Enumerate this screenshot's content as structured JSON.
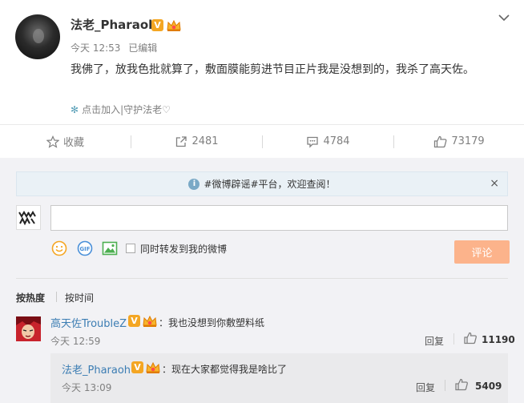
{
  "post": {
    "username": "法老_Pharaoh",
    "verified_badge": "V",
    "time": "今天 12:53",
    "edited": "已编辑",
    "content": "我佛了，放我色批就算了，敷面膜能剪进节目正片我是没想到的，我杀了高天佐。",
    "source": "点击加入|守护法老♡",
    "actions": {
      "favorite": "收藏",
      "repost": "2481",
      "comment": "4784",
      "like": "73179"
    }
  },
  "notice": {
    "text": "#微博辟谣#平台，欢迎查阅！",
    "close": "×"
  },
  "composer": {
    "input_value": "",
    "also_repost": "同时转发到我的微博",
    "submit": "评论"
  },
  "sort": {
    "by_hot": "按热度",
    "by_time": "按时间"
  },
  "comments": [
    {
      "username": "高天佐TroubleZ",
      "verified_badge": "V",
      "text": "：我也没想到你敷塑料纸",
      "time": "今天 12:59",
      "reply": "回复",
      "likes": "11190",
      "replies": [
        {
          "username": "法老_Pharaoh",
          "verified_badge": "V",
          "text": "：现在大家都觉得我是啥比了",
          "time": "今天 13:09",
          "reply": "回复",
          "likes": "5409"
        }
      ]
    }
  ],
  "colors": {
    "link_blue": "#3c7db3",
    "badge_orange": "#f4a623",
    "submit_disabled": "#fcb38b",
    "notice_bg": "#eaf1f6"
  }
}
